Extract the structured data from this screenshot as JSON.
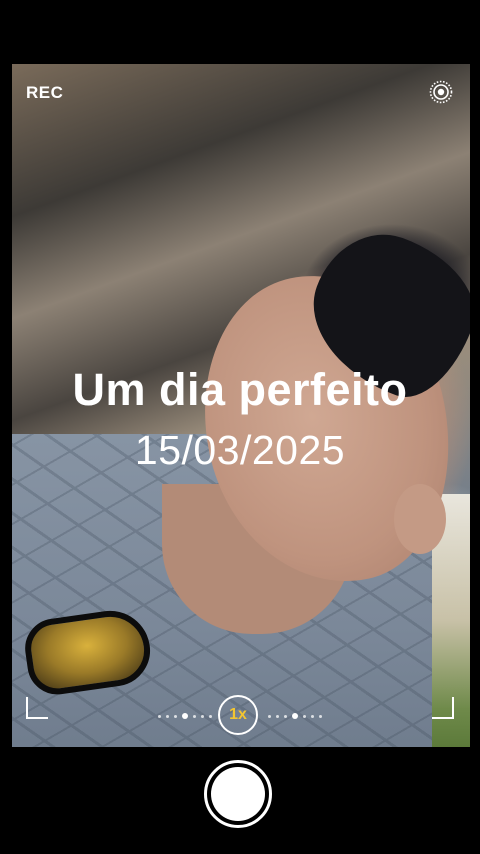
{
  "status": {
    "rec_label": "REC"
  },
  "overlay": {
    "title": "Um dia perfeito",
    "date": "15/03/2025"
  },
  "controls": {
    "zoom_label": "1x",
    "zoom_color": "#f2c531",
    "live_icon": "live-photo-icon",
    "shutter_icon": "shutter-button"
  }
}
